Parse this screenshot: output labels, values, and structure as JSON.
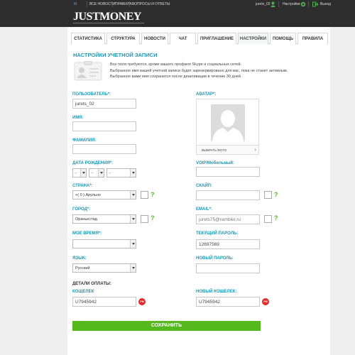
{
  "topbar": {
    "logo_mark": "III",
    "links": [
      "ВСЕ НОВОСТИ",
      "ПРАВИЛА",
      "ВОПРОСЫ И ОТВЕТЫ"
    ],
    "user": "jurets_02",
    "settings": "Настройки",
    "logout": "Выход"
  },
  "brand": {
    "name": "JUSTMONEY"
  },
  "tabs": [
    "СТАТИСТИКА",
    "СТРУКТУРА",
    "НОВОСТИ",
    "ЧАТ",
    "ПРИГЛАШЕНИЕ",
    "НАСТРОЙКИ",
    "ПОМОЩЬ",
    "ПРАВИЛА"
  ],
  "active_tab": "НАСТРОЙКИ",
  "section_title": "НАСТРОЙКИ УЧЕТНОЙ ЗАПИСИ",
  "info": {
    "line1": "Все поля требуются, кроме вашего профиля Skype и социальных сетей.",
    "line2": "Выбранное имя вашей учетной записи будет зарезервировано для вас, пока не станет активным.",
    "line3": "Выбранное вами имя сохранится после деактивации в течение 30 дней."
  },
  "form": {
    "username": {
      "label": "ПОЛЬЗОВАТЕЛЬ*:",
      "value": "jurets_02"
    },
    "first_name": {
      "label": "ИМЯ:",
      "value": ""
    },
    "last_name": {
      "label": "ФАМИЛИЯ:",
      "value": ""
    },
    "birth_date": {
      "label": "ДАТА РОЖДЕНИЯ*:",
      "day": "-",
      "month": "-",
      "year": "-"
    },
    "country": {
      "label": "СТРАНА*:",
      "value": "+( 0 ) Арульно"
    },
    "city": {
      "label": "ГОРОД*:",
      "value": "Ораньестад"
    },
    "timezone": {
      "label": "МОЕ ВРЕМЯ*:",
      "value": ""
    },
    "language": {
      "label": "ЯЗЫК:",
      "value": "Русский"
    },
    "avatar": {
      "label": "АВАТАР*:",
      "button": "ВЫБРАТЬ ФОТО"
    },
    "voip": {
      "label": "VOIP/Мобильный:",
      "value": ""
    },
    "skype": {
      "label": "СКАЙП:",
      "value": ""
    },
    "email": {
      "label": "EMAIL*:",
      "value": "jurets75@rambler.ru"
    },
    "current_password": {
      "label": "ТЕКУЩИЙ ПАРОЛЬ:",
      "value": "12697569"
    },
    "new_password": {
      "label": "НОВЫЙ ПАРОЛЬ:",
      "value": ""
    }
  },
  "payment": {
    "title": "ДЕТАЛИ ОПЛАТЫ:",
    "wallet": {
      "label": "КОШЕЛЕК",
      "value": "U7945942",
      "badge": "PM"
    },
    "new_wallet": {
      "label": "НОВЫЙ КОШЕЛЕК:",
      "value": "U7945942",
      "badge": "PM"
    }
  },
  "question_mark": "?",
  "save_label": "СОХРАНИТЬ",
  "colors": {
    "accent": "#1a98b5",
    "save": "#55b81c",
    "help": "#55b52f",
    "badge": "#e32a2a"
  }
}
